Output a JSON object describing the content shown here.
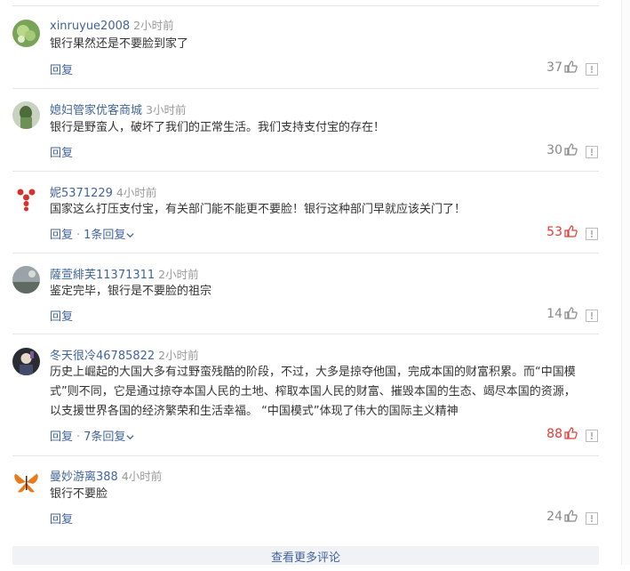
{
  "comments": [
    {
      "user": "xinruyue2008",
      "time": "2小时前",
      "text": "银行果然还是不要脸到家了",
      "reply": "回复",
      "replies": "",
      "likes": "37",
      "hot": false,
      "avatar": "green-bubble"
    },
    {
      "user": "媳妇管家优客商城",
      "time": "3小时前",
      "text": "银行是野蛮人，破坏了我们的正常生活。我们支持支付宝的存在！",
      "reply": "回复",
      "replies": "",
      "likes": "30",
      "hot": false,
      "avatar": "green-figure"
    },
    {
      "user": "妮5371229",
      "time": "4小时前",
      "text": "国家这么打压支付宝，有关部门能不能更不要脸！银行这种部门早就应该关门了！",
      "reply": "回复",
      "replies": "1条回复",
      "likes": "53",
      "hot": true,
      "avatar": "red-flower"
    },
    {
      "user": "薩萱緋芙11371311",
      "time": "2小时前",
      "text": "鉴定完毕，银行是不要脸的祖宗",
      "reply": "回复",
      "replies": "",
      "likes": "14",
      "hot": false,
      "avatar": "grey-landscape"
    },
    {
      "user": "冬天很冷46785822",
      "time": "2小时前",
      "text": "历史上崛起的大国大多有过野蛮残酷的阶段，不过，大多是掠夺他国，完成本国的财富积累。而“中国模式”则不同，它是通过掠夺本国人民的土地、榨取本国人民的财富、摧毁本国的生态、竭尽本国的资源，以支援世界各国的经济繁荣和生活幸福。 “中国模式”体现了伟大的国际主义精神",
      "reply": "回复",
      "replies": "7条回复",
      "likes": "88",
      "hot": true,
      "avatar": "dark-portrait"
    },
    {
      "user": "曼妙游离388",
      "time": "4小时前",
      "text": "银行不要脸",
      "reply": "回复",
      "replies": "",
      "likes": "24",
      "hot": false,
      "avatar": "orange-butterfly"
    }
  ],
  "icons": {
    "like": "thumbs-up-icon",
    "report": "report-icon",
    "chevron": "chevron-down-icon"
  },
  "colors": {
    "username": "#406599",
    "hot_likes": "#e53935",
    "likes": "#888888"
  },
  "more_comments": "查看更多评论"
}
